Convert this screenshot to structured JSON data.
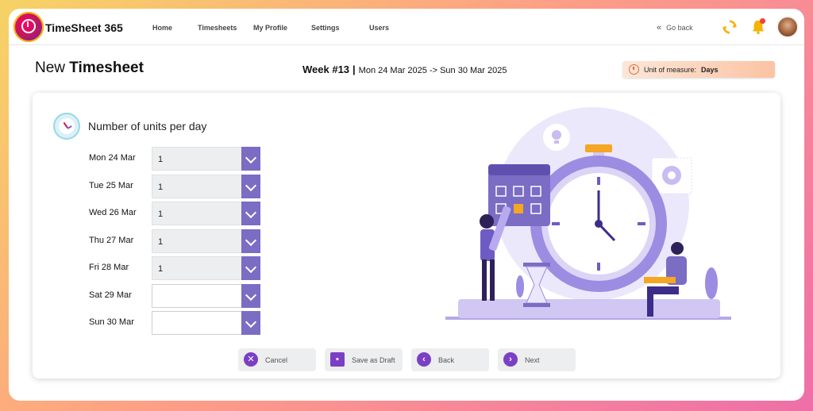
{
  "app": {
    "brand": "TimeSheet 365"
  },
  "nav": {
    "links": [
      "Home",
      "Timesheets",
      "My Profile",
      "Settings",
      "Users"
    ],
    "go_back": "Go back"
  },
  "header": {
    "title_prefix": "New",
    "title_bold": "Timesheet",
    "week_label": "Week #13",
    "week_range": "Mon 24 Mar 2025 -> Sun 30 Mar 2025",
    "uom_label": "Unit of measure:",
    "uom_value": "Days"
  },
  "form": {
    "title": "Number of units per day",
    "days": [
      {
        "label": "Mon 24 Mar",
        "value": "1"
      },
      {
        "label": "Tue 25 Mar",
        "value": "1"
      },
      {
        "label": "Wed 26 Mar",
        "value": "1"
      },
      {
        "label": "Thu 27 Mar",
        "value": "1"
      },
      {
        "label": "Fri 28 Mar",
        "value": "1"
      },
      {
        "label": "Sat 29 Mar",
        "value": ""
      },
      {
        "label": "Sun 30 Mar",
        "value": ""
      }
    ]
  },
  "actions": {
    "cancel": "Cancel",
    "save_draft": "Save as Draft",
    "back": "Back",
    "next": "Next"
  },
  "colors": {
    "accent": "#7b6cc4",
    "action_icon": "#7b3fc4",
    "uom_bg": "#fbc3a3"
  }
}
